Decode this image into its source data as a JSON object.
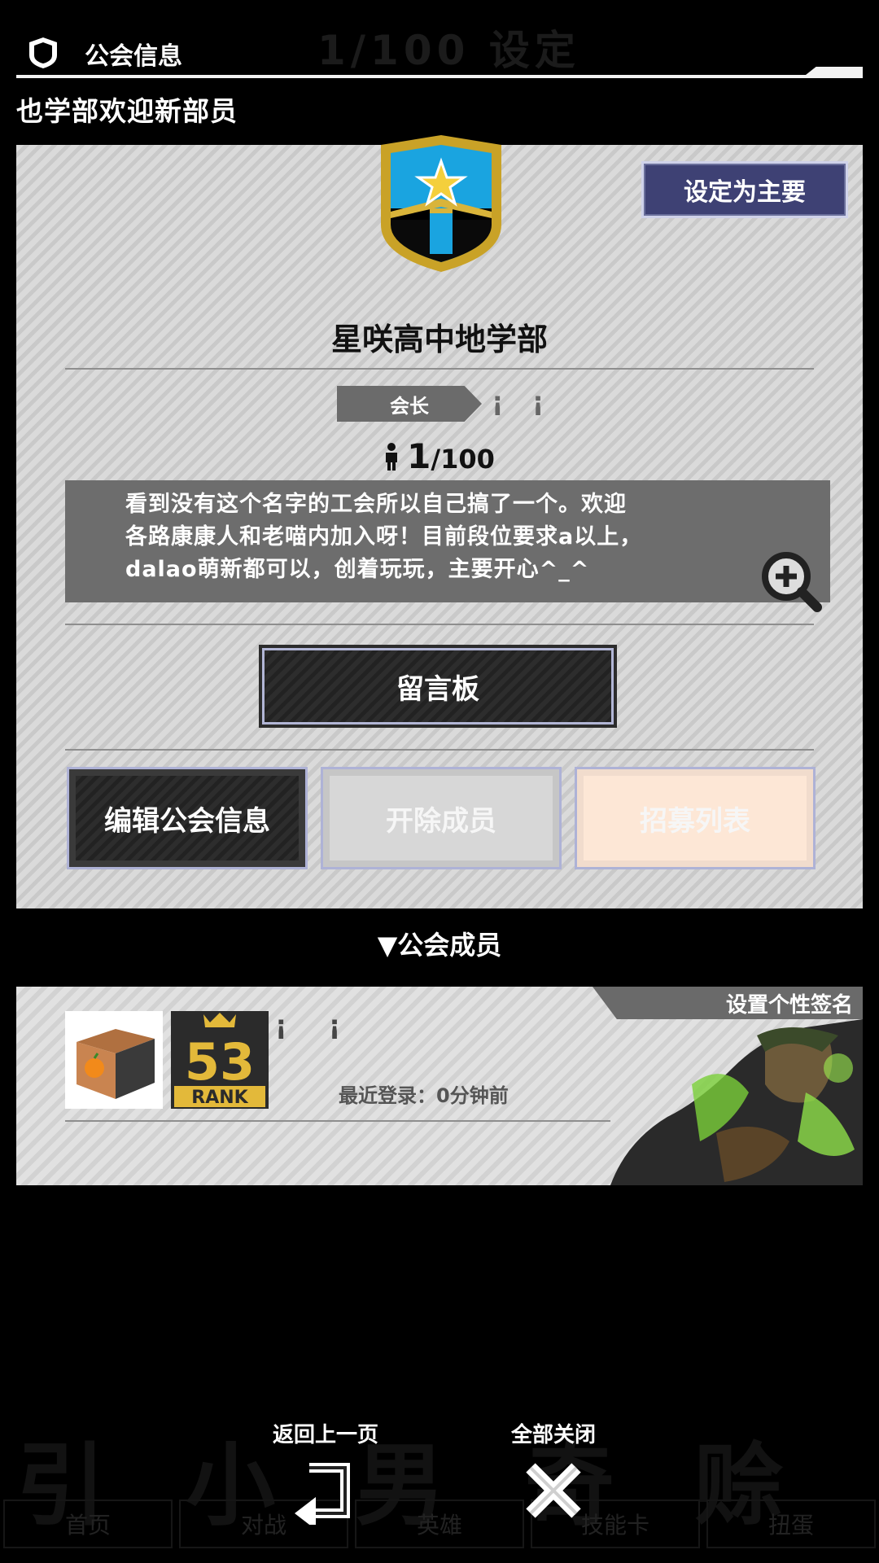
{
  "header": {
    "title": "公会信息",
    "icon": "shield-icon"
  },
  "subtitle": "也学部欢迎新部员",
  "guild": {
    "set_primary_label": "设定为主要",
    "name": "星咲高中地学部",
    "role_label": "会长",
    "leader_name": "¡ ¡",
    "member_current": "1",
    "member_max": "/100",
    "description": [
      "看到没有这个名字的工会所以自己搞了一个。欢迎",
      "各路康康人和老喵内加入呀！目前段位要求a以上，",
      "dalao萌新都可以，创着玩玩，主要开心^_^"
    ],
    "message_board_label": "留言板",
    "actions": {
      "edit": "编辑公会信息",
      "kick": "开除成员",
      "recruit": "招募列表"
    }
  },
  "members": {
    "header": "▼公会成员",
    "list": [
      {
        "name": "¡ ¡",
        "rank": "53",
        "rank_label": "RANK",
        "last_login": "最近登录：0分钟前",
        "signature_label": "设置个性签名"
      }
    ]
  },
  "nav": {
    "back_label": "返回上一页",
    "close_all_label": "全部关闭"
  },
  "background": {
    "top_right": "1/100 设定",
    "big_text": "引 小 男 奇 赊",
    "tabs": [
      "首页",
      "对战",
      "英雄",
      "技能卡",
      "扭蛋"
    ]
  },
  "colors": {
    "primary_button": "#3e4174",
    "rank_gold": "#e3b93a",
    "emblem_gold": "#c9a227",
    "emblem_blue": "#1aa4e0",
    "recruit_button": "#fde7d6"
  }
}
